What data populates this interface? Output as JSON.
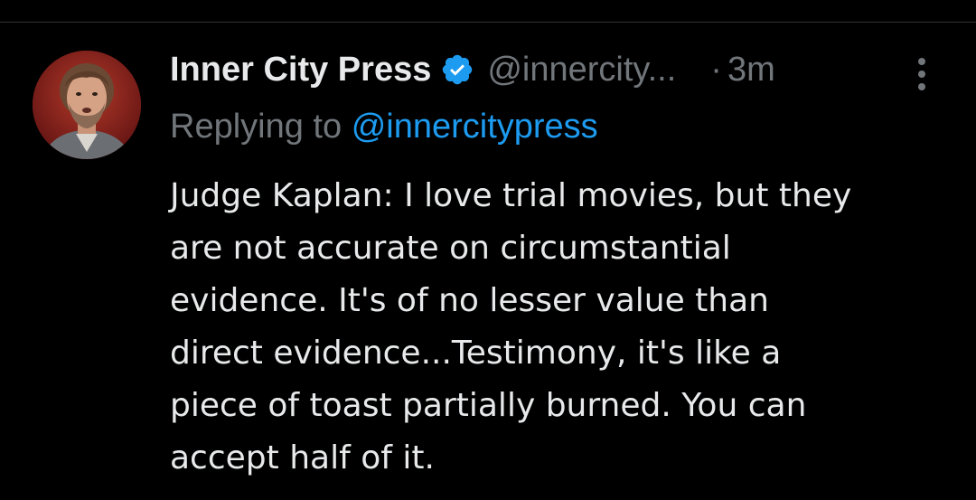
{
  "tweet": {
    "author": {
      "name": "Inner City Press",
      "handle": "@innercity...",
      "verified": true
    },
    "time_separator": "·",
    "time": "3m",
    "replying_to_prefix": "Replying to",
    "replying_to_handle": "@innercitypress",
    "text_lines": [
      "Judge Kaplan: I love trial movies, but they",
      "are not accurate on circumstantial",
      "evidence. It's of no lesser value than",
      "direct evidence...Testimony, it's like a",
      "piece of toast partially burned. You can",
      "accept half of it."
    ]
  },
  "icons": {
    "verified": "verified-badge-icon",
    "more": "more-options-icon"
  },
  "colors": {
    "background": "#000000",
    "primary_text": "#e7e9ea",
    "secondary_text": "#71767b",
    "accent": "#1d9bf0",
    "divider": "#2f3336"
  }
}
